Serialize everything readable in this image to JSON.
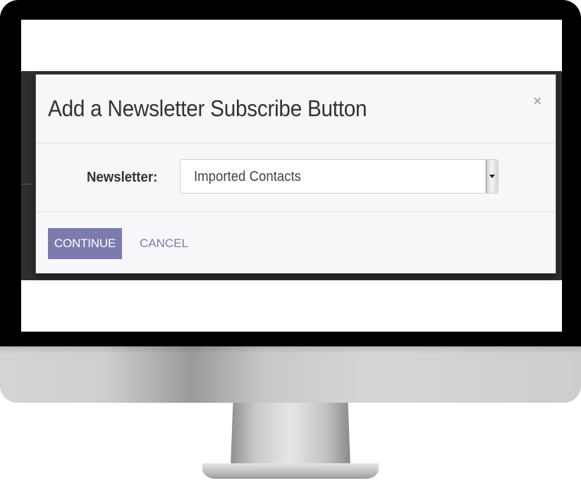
{
  "dialog": {
    "title": "Add a Newsletter Subscribe Button",
    "close_icon": "close-icon",
    "close_glyph": "×"
  },
  "form": {
    "newsletter_label": "Newsletter:",
    "newsletter_selected": "Imported Contacts"
  },
  "footer": {
    "continue_label": "CONTINUE",
    "cancel_label": "CANCEL"
  },
  "colors": {
    "primary": "#7c7bad",
    "backdrop": "#2f2f2f",
    "dialog_bg": "#f7f7f9"
  }
}
